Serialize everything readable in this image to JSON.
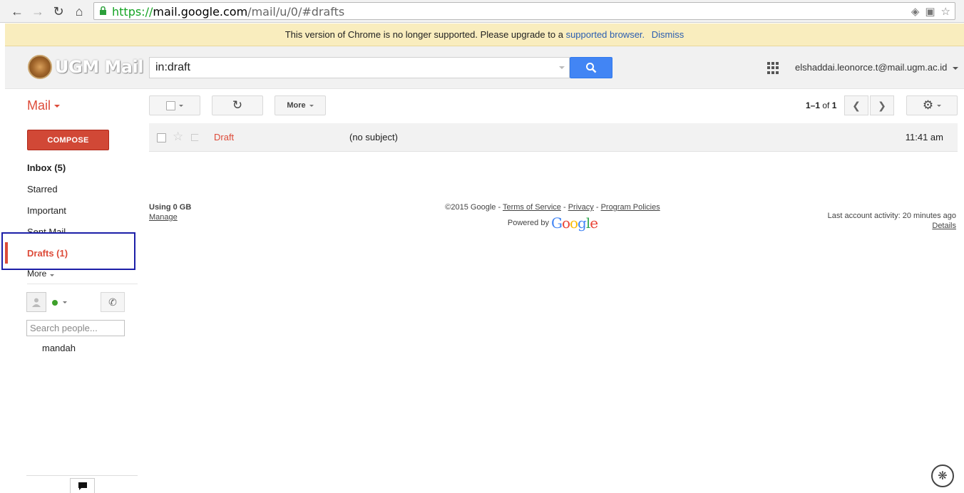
{
  "browser": {
    "url_scheme": "https://",
    "url_host": "mail.google.com",
    "url_path": "/mail/u/0/#drafts"
  },
  "infobar": {
    "message": "This version of Chrome is no longer supported. Please upgrade to a",
    "link_text": "supported browser.",
    "dismiss_text": "Dismiss"
  },
  "header": {
    "logo_text": "UGM Mail",
    "search_value": "in:draft",
    "account_email": "elshaddai.leonorce.t@mail.ugm.ac.id"
  },
  "toolbar": {
    "mail_label": "Mail",
    "more_label": "More",
    "pager_range": "1–1",
    "pager_of": "of",
    "pager_total": "1"
  },
  "sidebar": {
    "compose_label": "COMPOSE",
    "items": [
      {
        "label": "Inbox (5)"
      },
      {
        "label": "Starred"
      },
      {
        "label": "Important"
      },
      {
        "label": "Sent Mail"
      },
      {
        "label": "Drafts (1)"
      },
      {
        "label": "More"
      }
    ],
    "people_search_placeholder": "Search people...",
    "contact_name": "mandah"
  },
  "messages": [
    {
      "sender": "Draft",
      "subject": "(no subject)",
      "time": "11:41 am"
    }
  ],
  "footer": {
    "usage": "Using 0 GB",
    "manage": "Manage",
    "copyright": "©2015 Google -",
    "terms": "Terms of Service",
    "sep1": "-",
    "privacy": "Privacy",
    "sep2": "-",
    "policies": "Program Policies",
    "powered_by": "Powered by",
    "google_logo": "Google",
    "last_activity": "Last account activity: 20 minutes ago",
    "details": "Details"
  },
  "colors": {
    "accent_red": "#dd4b39",
    "compose_red": "#d14836",
    "search_blue": "#4285f4",
    "infobar_yellow": "#f9edbe",
    "highlight_box": "#1c1fa8"
  }
}
